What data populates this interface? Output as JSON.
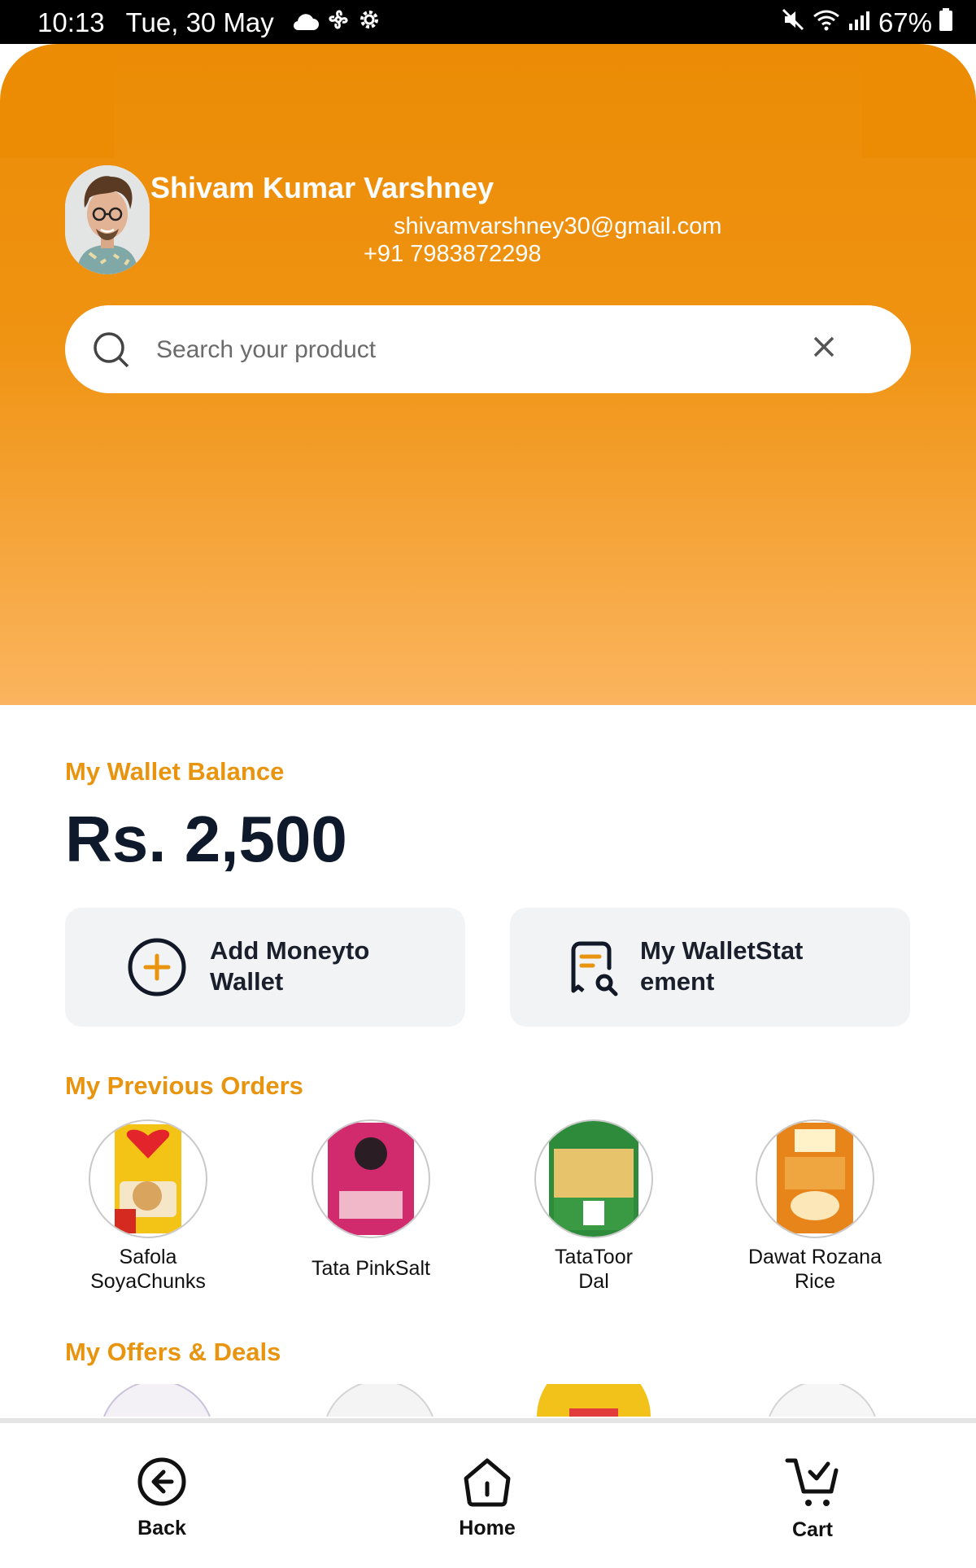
{
  "status_bar": {
    "time": "10:13",
    "date": "Tue, 30 May",
    "battery": "67%",
    "icons_left": [
      "cloud-icon",
      "fan-icon",
      "settings-icon"
    ],
    "icons_right": [
      "mute-icon",
      "wifi-icon",
      "signal-icon",
      "battery-icon"
    ]
  },
  "profile": {
    "name": "Shivam Kumar Varshney",
    "email": "shivamvarshney30@gmail.com",
    "phone": "+91 7983872298"
  },
  "search": {
    "placeholder": "Search your product",
    "value": ""
  },
  "wallet": {
    "title": "My Wallet Balance",
    "balance": "Rs. 2,500",
    "add_money_label": "Add Moneyto Wallet",
    "add_money_line1": "Add Moneyto",
    "add_money_line2": "Wallet",
    "statement_line1": "My WalletStat",
    "statement_line2": "ement"
  },
  "orders": {
    "title": "My Previous Orders",
    "items": [
      {
        "line1": "Safola",
        "line2": "SoyaChunks"
      },
      {
        "line1": "Tata PinkSalt",
        "line2": ""
      },
      {
        "line1": "TataToor",
        "line2": "Dal"
      },
      {
        "line1": "Dawat Rozana",
        "line2": "Rice"
      }
    ]
  },
  "offers": {
    "title": "My Offers & Deals"
  },
  "nav": {
    "back": "Back",
    "home": "Home",
    "cart": "Cart"
  },
  "colors": {
    "accent": "#e8940e",
    "header_top": "#ec8c05",
    "header_bottom": "#fbb45e",
    "text_dark": "#0e1a2b"
  }
}
